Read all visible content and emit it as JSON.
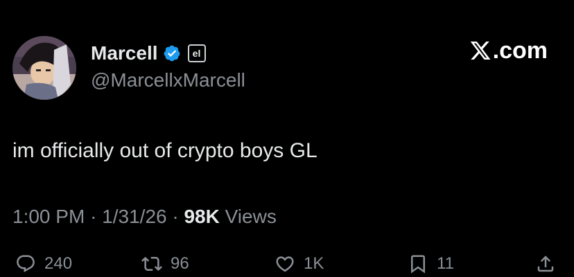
{
  "user": {
    "display_name": "Marcell",
    "handle": "@MarcellxMarcell",
    "affiliate_badge_text": "el",
    "verified_color": "#1d9bf0"
  },
  "source_label": ".com",
  "tweet": {
    "text": "im officially out of crypto boys GL",
    "time": "1:00 PM",
    "date": "1/31/26",
    "views_count": "98K",
    "views_label": "Views"
  },
  "actions": {
    "replies": "240",
    "reposts": "96",
    "likes": "1K",
    "bookmarks": "11"
  },
  "colors": {
    "background": "#000000",
    "text_primary": "#e7e9ea",
    "text_secondary": "#8b9096"
  }
}
